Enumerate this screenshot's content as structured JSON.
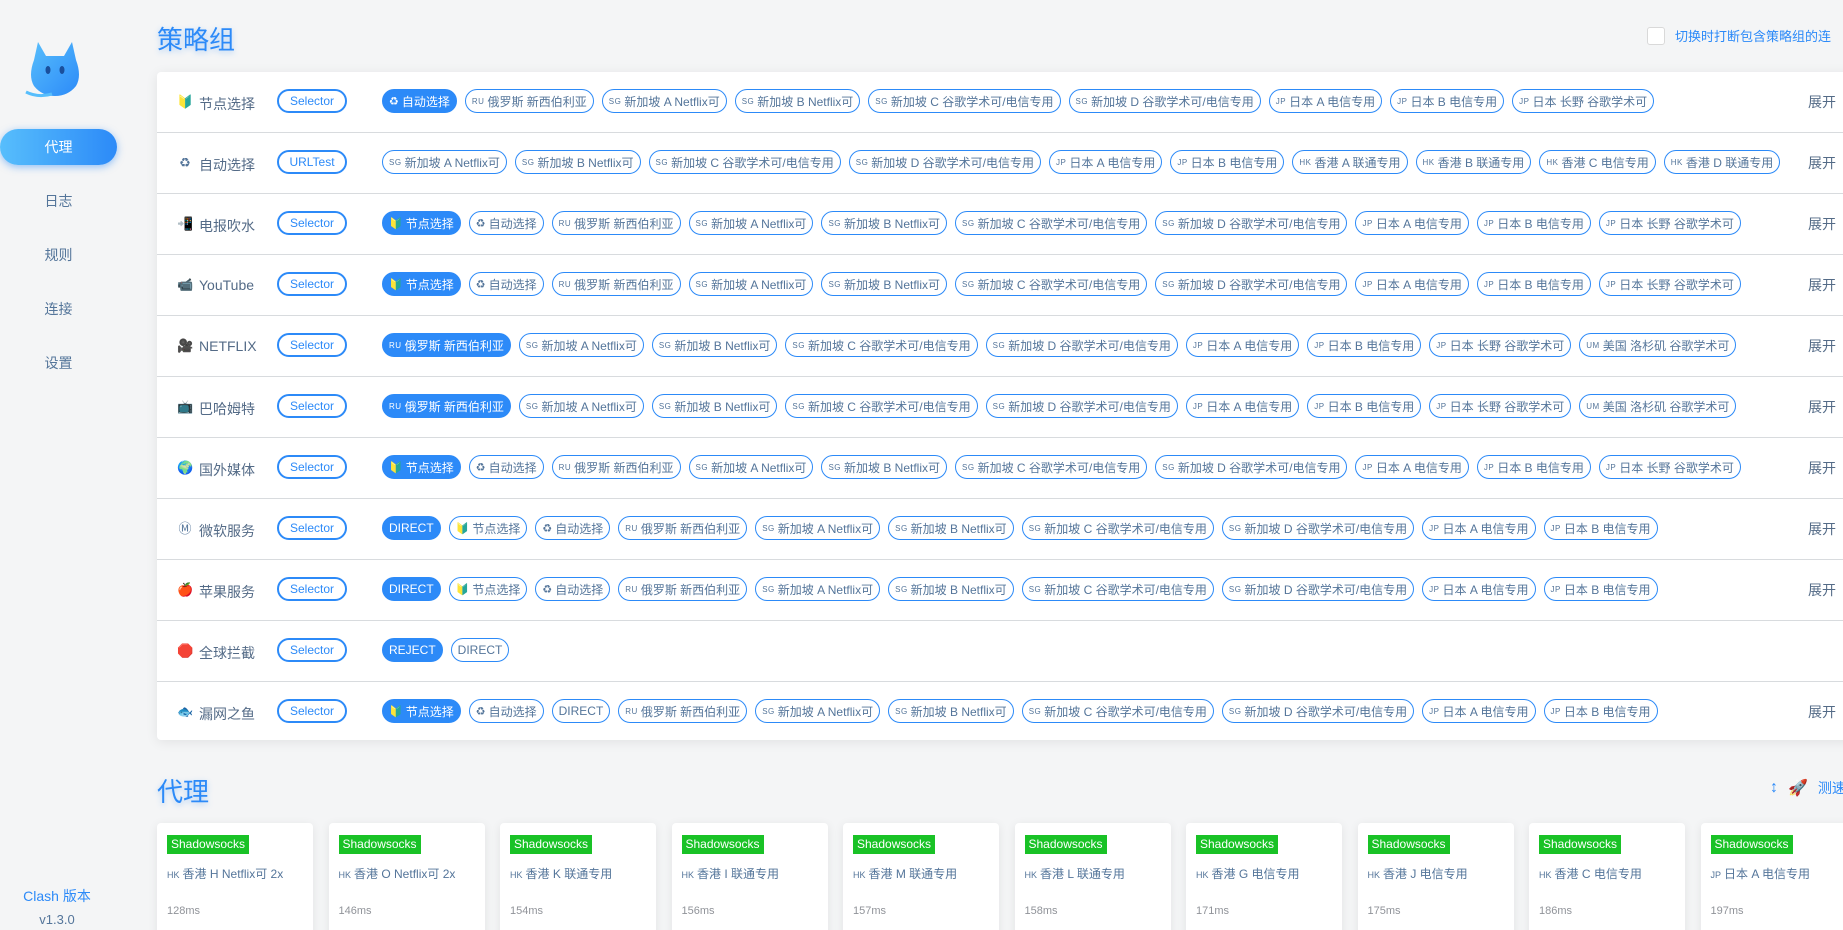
{
  "sidebar": {
    "items": [
      "代理",
      "日志",
      "规则",
      "连接",
      "设置"
    ],
    "version_label": "Clash 版本",
    "version": "v1.3.0"
  },
  "groups_section": {
    "title": "策略组",
    "toggle_label": "切换时打断包含策略组的连"
  },
  "expand_label": "展开",
  "groups": [
    {
      "name": "节点选择",
      "icon": "🔰",
      "type": "Selector",
      "proxies": [
        [
          "",
          "♻",
          "自动选择",
          true
        ],
        [
          "RU",
          "",
          "俄罗斯 新西伯利亚",
          false
        ],
        [
          "SG",
          "",
          "新加坡 A Netflix可",
          false
        ],
        [
          "SG",
          "",
          "新加坡 B Netflix可",
          false
        ],
        [
          "SG",
          "",
          "新加坡 C 谷歌学术可/电信专用",
          false
        ],
        [
          "SG",
          "",
          "新加坡 D 谷歌学术可/电信专用",
          false
        ],
        [
          "JP",
          "",
          "日本 A 电信专用",
          false
        ],
        [
          "JP",
          "",
          "日本 B 电信专用",
          false
        ],
        [
          "JP",
          "",
          "日本 长野 谷歌学术可",
          false
        ]
      ],
      "expand": true
    },
    {
      "name": "自动选择",
      "icon": "♻",
      "type": "URLTest",
      "proxies": [
        [
          "SG",
          "",
          "新加坡 A Netflix可",
          false
        ],
        [
          "SG",
          "",
          "新加坡 B Netflix可",
          false
        ],
        [
          "SG",
          "",
          "新加坡 C 谷歌学术可/电信专用",
          false
        ],
        [
          "SG",
          "",
          "新加坡 D 谷歌学术可/电信专用",
          false
        ],
        [
          "JP",
          "",
          "日本 A 电信专用",
          false
        ],
        [
          "JP",
          "",
          "日本 B 电信专用",
          false
        ],
        [
          "HK",
          "",
          "香港 A 联通专用",
          false
        ],
        [
          "HK",
          "",
          "香港 B 联通专用",
          false
        ],
        [
          "HK",
          "",
          "香港 C 电信专用",
          false
        ],
        [
          "HK",
          "",
          "香港 D 联通专用",
          false
        ]
      ],
      "expand": true
    },
    {
      "name": "电报吹水",
      "icon": "📲",
      "type": "Selector",
      "proxies": [
        [
          "",
          "🔰",
          "节点选择",
          true
        ],
        [
          "",
          "♻",
          "自动选择",
          false
        ],
        [
          "RU",
          "",
          "俄罗斯 新西伯利亚",
          false
        ],
        [
          "SG",
          "",
          "新加坡 A Netflix可",
          false
        ],
        [
          "SG",
          "",
          "新加坡 B Netflix可",
          false
        ],
        [
          "SG",
          "",
          "新加坡 C 谷歌学术可/电信专用",
          false
        ],
        [
          "SG",
          "",
          "新加坡 D 谷歌学术可/电信专用",
          false
        ],
        [
          "JP",
          "",
          "日本 A 电信专用",
          false
        ],
        [
          "JP",
          "",
          "日本 B 电信专用",
          false
        ],
        [
          "JP",
          "",
          "日本 长野 谷歌学术可",
          false
        ]
      ],
      "expand": true
    },
    {
      "name": "YouTube",
      "icon": "📹",
      "type": "Selector",
      "proxies": [
        [
          "",
          "🔰",
          "节点选择",
          true
        ],
        [
          "",
          "♻",
          "自动选择",
          false
        ],
        [
          "RU",
          "",
          "俄罗斯 新西伯利亚",
          false
        ],
        [
          "SG",
          "",
          "新加坡 A Netflix可",
          false
        ],
        [
          "SG",
          "",
          "新加坡 B Netflix可",
          false
        ],
        [
          "SG",
          "",
          "新加坡 C 谷歌学术可/电信专用",
          false
        ],
        [
          "SG",
          "",
          "新加坡 D 谷歌学术可/电信专用",
          false
        ],
        [
          "JP",
          "",
          "日本 A 电信专用",
          false
        ],
        [
          "JP",
          "",
          "日本 B 电信专用",
          false
        ],
        [
          "JP",
          "",
          "日本 长野 谷歌学术可",
          false
        ]
      ],
      "expand": true
    },
    {
      "name": "NETFLIX",
      "icon": "🎥",
      "type": "Selector",
      "proxies": [
        [
          "RU",
          "",
          "俄罗斯 新西伯利亚",
          true
        ],
        [
          "SG",
          "",
          "新加坡 A Netflix可",
          false
        ],
        [
          "SG",
          "",
          "新加坡 B Netflix可",
          false
        ],
        [
          "SG",
          "",
          "新加坡 C 谷歌学术可/电信专用",
          false
        ],
        [
          "SG",
          "",
          "新加坡 D 谷歌学术可/电信专用",
          false
        ],
        [
          "JP",
          "",
          "日本 A 电信专用",
          false
        ],
        [
          "JP",
          "",
          "日本 B 电信专用",
          false
        ],
        [
          "JP",
          "",
          "日本 长野 谷歌学术可",
          false
        ],
        [
          "UM",
          "",
          "美国 洛杉矶 谷歌学术可",
          false
        ]
      ],
      "expand": true
    },
    {
      "name": "巴哈姆特",
      "icon": "📺",
      "type": "Selector",
      "proxies": [
        [
          "RU",
          "",
          "俄罗斯 新西伯利亚",
          true
        ],
        [
          "SG",
          "",
          "新加坡 A Netflix可",
          false
        ],
        [
          "SG",
          "",
          "新加坡 B Netflix可",
          false
        ],
        [
          "SG",
          "",
          "新加坡 C 谷歌学术可/电信专用",
          false
        ],
        [
          "SG",
          "",
          "新加坡 D 谷歌学术可/电信专用",
          false
        ],
        [
          "JP",
          "",
          "日本 A 电信专用",
          false
        ],
        [
          "JP",
          "",
          "日本 B 电信专用",
          false
        ],
        [
          "JP",
          "",
          "日本 长野 谷歌学术可",
          false
        ],
        [
          "UM",
          "",
          "美国 洛杉矶 谷歌学术可",
          false
        ]
      ],
      "expand": true
    },
    {
      "name": "国外媒体",
      "icon": "🌍",
      "type": "Selector",
      "proxies": [
        [
          "",
          "🔰",
          "节点选择",
          true
        ],
        [
          "",
          "♻",
          "自动选择",
          false
        ],
        [
          "RU",
          "",
          "俄罗斯 新西伯利亚",
          false
        ],
        [
          "SG",
          "",
          "新加坡 A Netflix可",
          false
        ],
        [
          "SG",
          "",
          "新加坡 B Netflix可",
          false
        ],
        [
          "SG",
          "",
          "新加坡 C 谷歌学术可/电信专用",
          false
        ],
        [
          "SG",
          "",
          "新加坡 D 谷歌学术可/电信专用",
          false
        ],
        [
          "JP",
          "",
          "日本 A 电信专用",
          false
        ],
        [
          "JP",
          "",
          "日本 B 电信专用",
          false
        ],
        [
          "JP",
          "",
          "日本 长野 谷歌学术可",
          false
        ]
      ],
      "expand": true
    },
    {
      "name": "微软服务",
      "icon": "Ⓜ",
      "type": "Selector",
      "proxies": [
        [
          "",
          "",
          "DIRECT",
          true
        ],
        [
          "",
          "🔰",
          "节点选择",
          false
        ],
        [
          "",
          "♻",
          "自动选择",
          false
        ],
        [
          "RU",
          "",
          "俄罗斯 新西伯利亚",
          false
        ],
        [
          "SG",
          "",
          "新加坡 A Netflix可",
          false
        ],
        [
          "SG",
          "",
          "新加坡 B Netflix可",
          false
        ],
        [
          "SG",
          "",
          "新加坡 C 谷歌学术可/电信专用",
          false
        ],
        [
          "SG",
          "",
          "新加坡 D 谷歌学术可/电信专用",
          false
        ],
        [
          "JP",
          "",
          "日本 A 电信专用",
          false
        ],
        [
          "JP",
          "",
          "日本 B 电信专用",
          false
        ]
      ],
      "expand": true
    },
    {
      "name": "苹果服务",
      "icon": "🍎",
      "type": "Selector",
      "proxies": [
        [
          "",
          "",
          "DIRECT",
          true
        ],
        [
          "",
          "🔰",
          "节点选择",
          false
        ],
        [
          "",
          "♻",
          "自动选择",
          false
        ],
        [
          "RU",
          "",
          "俄罗斯 新西伯利亚",
          false
        ],
        [
          "SG",
          "",
          "新加坡 A Netflix可",
          false
        ],
        [
          "SG",
          "",
          "新加坡 B Netflix可",
          false
        ],
        [
          "SG",
          "",
          "新加坡 C 谷歌学术可/电信专用",
          false
        ],
        [
          "SG",
          "",
          "新加坡 D 谷歌学术可/电信专用",
          false
        ],
        [
          "JP",
          "",
          "日本 A 电信专用",
          false
        ],
        [
          "JP",
          "",
          "日本 B 电信专用",
          false
        ]
      ],
      "expand": true
    },
    {
      "name": "全球拦截",
      "icon": "🛑",
      "type": "Selector",
      "proxies": [
        [
          "",
          "",
          "REJECT",
          true
        ],
        [
          "",
          "",
          "DIRECT",
          false
        ]
      ],
      "expand": false
    },
    {
      "name": "漏网之鱼",
      "icon": "🐟",
      "type": "Selector",
      "proxies": [
        [
          "",
          "🔰",
          "节点选择",
          true
        ],
        [
          "",
          "♻",
          "自动选择",
          false
        ],
        [
          "",
          "",
          "DIRECT",
          false
        ],
        [
          "RU",
          "",
          "俄罗斯 新西伯利亚",
          false
        ],
        [
          "SG",
          "",
          "新加坡 A Netflix可",
          false
        ],
        [
          "SG",
          "",
          "新加坡 B Netflix可",
          false
        ],
        [
          "SG",
          "",
          "新加坡 C 谷歌学术可/电信专用",
          false
        ],
        [
          "SG",
          "",
          "新加坡 D 谷歌学术可/电信专用",
          false
        ],
        [
          "JP",
          "",
          "日本 A 电信专用",
          false
        ],
        [
          "JP",
          "",
          "日本 B 电信专用",
          false
        ]
      ],
      "expand": true
    }
  ],
  "proxies_section": {
    "title": "代理",
    "test_label": "测速"
  },
  "proxy_cards": [
    {
      "type": "Shadowsocks",
      "cc": "HK",
      "name": "香港 H Netflix可 2x",
      "delay": "128ms"
    },
    {
      "type": "Shadowsocks",
      "cc": "HK",
      "name": "香港 O Netflix可 2x",
      "delay": "146ms"
    },
    {
      "type": "Shadowsocks",
      "cc": "HK",
      "name": "香港 K 联通专用",
      "delay": "154ms"
    },
    {
      "type": "Shadowsocks",
      "cc": "HK",
      "name": "香港 I 联通专用",
      "delay": "156ms"
    },
    {
      "type": "Shadowsocks",
      "cc": "HK",
      "name": "香港 M 联通专用",
      "delay": "157ms"
    },
    {
      "type": "Shadowsocks",
      "cc": "HK",
      "name": "香港 L 联通专用",
      "delay": "158ms"
    },
    {
      "type": "Shadowsocks",
      "cc": "HK",
      "name": "香港 G 电信专用",
      "delay": "171ms"
    },
    {
      "type": "Shadowsocks",
      "cc": "HK",
      "name": "香港 J 电信专用",
      "delay": "175ms"
    },
    {
      "type": "Shadowsocks",
      "cc": "HK",
      "name": "香港 C 电信专用",
      "delay": "186ms"
    },
    {
      "type": "Shadowsocks",
      "cc": "JP",
      "name": "日本 A 电信专用",
      "delay": "197ms"
    }
  ],
  "colors": {
    "accent": "#2c8af8",
    "badge": "#19c226",
    "text": "#54759a"
  }
}
